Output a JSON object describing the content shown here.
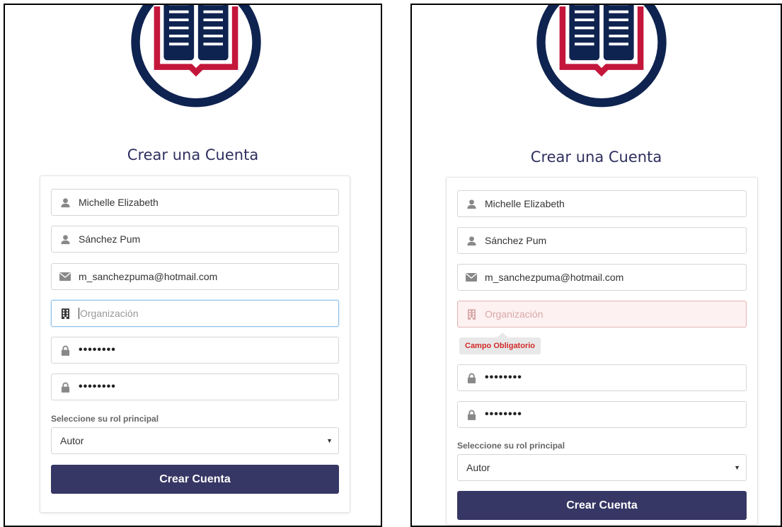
{
  "panels": [
    {
      "title": "Crear una Cuenta",
      "fields": {
        "first_name": "Michelle Elizabeth",
        "last_name": "Sánchez Pum",
        "email": "m_sanchezpuma@hotmail.com",
        "organization_placeholder": "Organización",
        "password": "••••••••",
        "confirm_password": "••••••••"
      },
      "role_label": "Seleccione su rol principal",
      "role_value": "Autor",
      "submit_label": "Crear Cuenta"
    },
    {
      "title": "Crear una Cuenta",
      "fields": {
        "first_name": "Michelle Elizabeth",
        "last_name": "Sánchez Pum",
        "email": "m_sanchezpuma@hotmail.com",
        "organization_placeholder": "Organización",
        "password": "••••••••",
        "confirm_password": "••••••••"
      },
      "error_message": "Campo Obligatorio",
      "role_label": "Seleccione su rol principal",
      "role_value": "Autor",
      "submit_label": "Crear Cuenta"
    }
  ],
  "colors": {
    "navy": "#0f2350",
    "red": "#c4163b",
    "gray_arc": "#666666",
    "button": "#373765",
    "error_text": "#d12a2a"
  },
  "icons": [
    "book-logo-icon",
    "user-icon",
    "envelope-icon",
    "building-icon",
    "lock-icon",
    "chevron-down-icon"
  ]
}
